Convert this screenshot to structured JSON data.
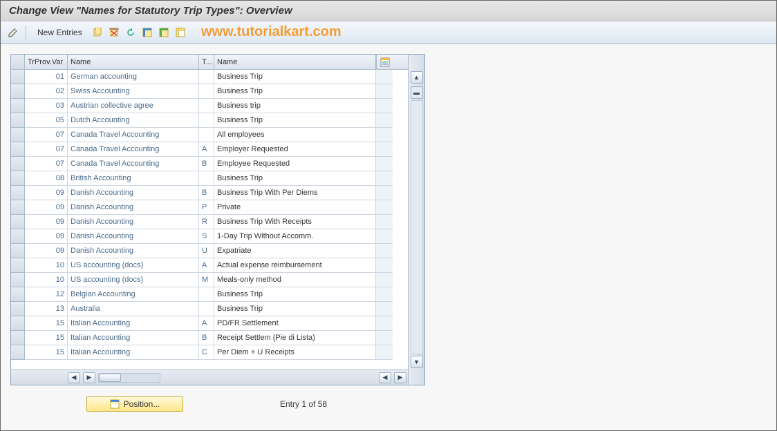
{
  "title": "Change View \"Names for Statutory Trip Types\": Overview",
  "watermark": "www.tutorialkart.com",
  "toolbar": {
    "new_entries": "New Entries"
  },
  "columns": {
    "var": "TrProv.Var",
    "name1": "Name",
    "t": "T...",
    "name2": "Name"
  },
  "rows": [
    {
      "var": "01",
      "name1": "German accounting",
      "t": "",
      "name2": "Business Trip"
    },
    {
      "var": "02",
      "name1": "Swiss Accounting",
      "t": "",
      "name2": "Business Trip"
    },
    {
      "var": "03",
      "name1": "Austrian collective agree",
      "t": "",
      "name2": "Business trip"
    },
    {
      "var": "05",
      "name1": "Dutch Accounting",
      "t": "",
      "name2": "Business Trip"
    },
    {
      "var": "07",
      "name1": "Canada Travel Accounting",
      "t": "",
      "name2": "All employees"
    },
    {
      "var": "07",
      "name1": "Canada Travel Accounting",
      "t": "A",
      "name2": "Employer Requested"
    },
    {
      "var": "07",
      "name1": "Canada Travel Accounting",
      "t": "B",
      "name2": "Employee Requested"
    },
    {
      "var": "08",
      "name1": "British Accounting",
      "t": "",
      "name2": "Business Trip"
    },
    {
      "var": "09",
      "name1": "Danish Accounting",
      "t": "B",
      "name2": "Business Trip With Per Diems"
    },
    {
      "var": "09",
      "name1": "Danish Accounting",
      "t": "P",
      "name2": "Private"
    },
    {
      "var": "09",
      "name1": "Danish Accounting",
      "t": "R",
      "name2": "Business Trip With Receipts"
    },
    {
      "var": "09",
      "name1": "Danish Accounting",
      "t": "S",
      "name2": "1-Day Trip Without Accomm."
    },
    {
      "var": "09",
      "name1": "Danish Accounting",
      "t": "U",
      "name2": "Expatriate"
    },
    {
      "var": "10",
      "name1": "US accounting (docs)",
      "t": "A",
      "name2": "Actual expense reimbursement"
    },
    {
      "var": "10",
      "name1": "US accounting (docs)",
      "t": "M",
      "name2": "Meals-only method"
    },
    {
      "var": "12",
      "name1": "Belgian Accounting",
      "t": "",
      "name2": "Business Trip"
    },
    {
      "var": "13",
      "name1": "Australia",
      "t": "",
      "name2": "Business Trip"
    },
    {
      "var": "15",
      "name1": "Italian Accounting",
      "t": "A",
      "name2": "PD/FR Settlement"
    },
    {
      "var": "15",
      "name1": "Italian Accounting",
      "t": "B",
      "name2": "Receipt Settlem (Pie di Lista)"
    },
    {
      "var": "15",
      "name1": "Italian Accounting",
      "t": "C",
      "name2": "Per Diem + U Receipts"
    }
  ],
  "footer": {
    "position": "Position...",
    "entry": "Entry 1 of 58"
  }
}
